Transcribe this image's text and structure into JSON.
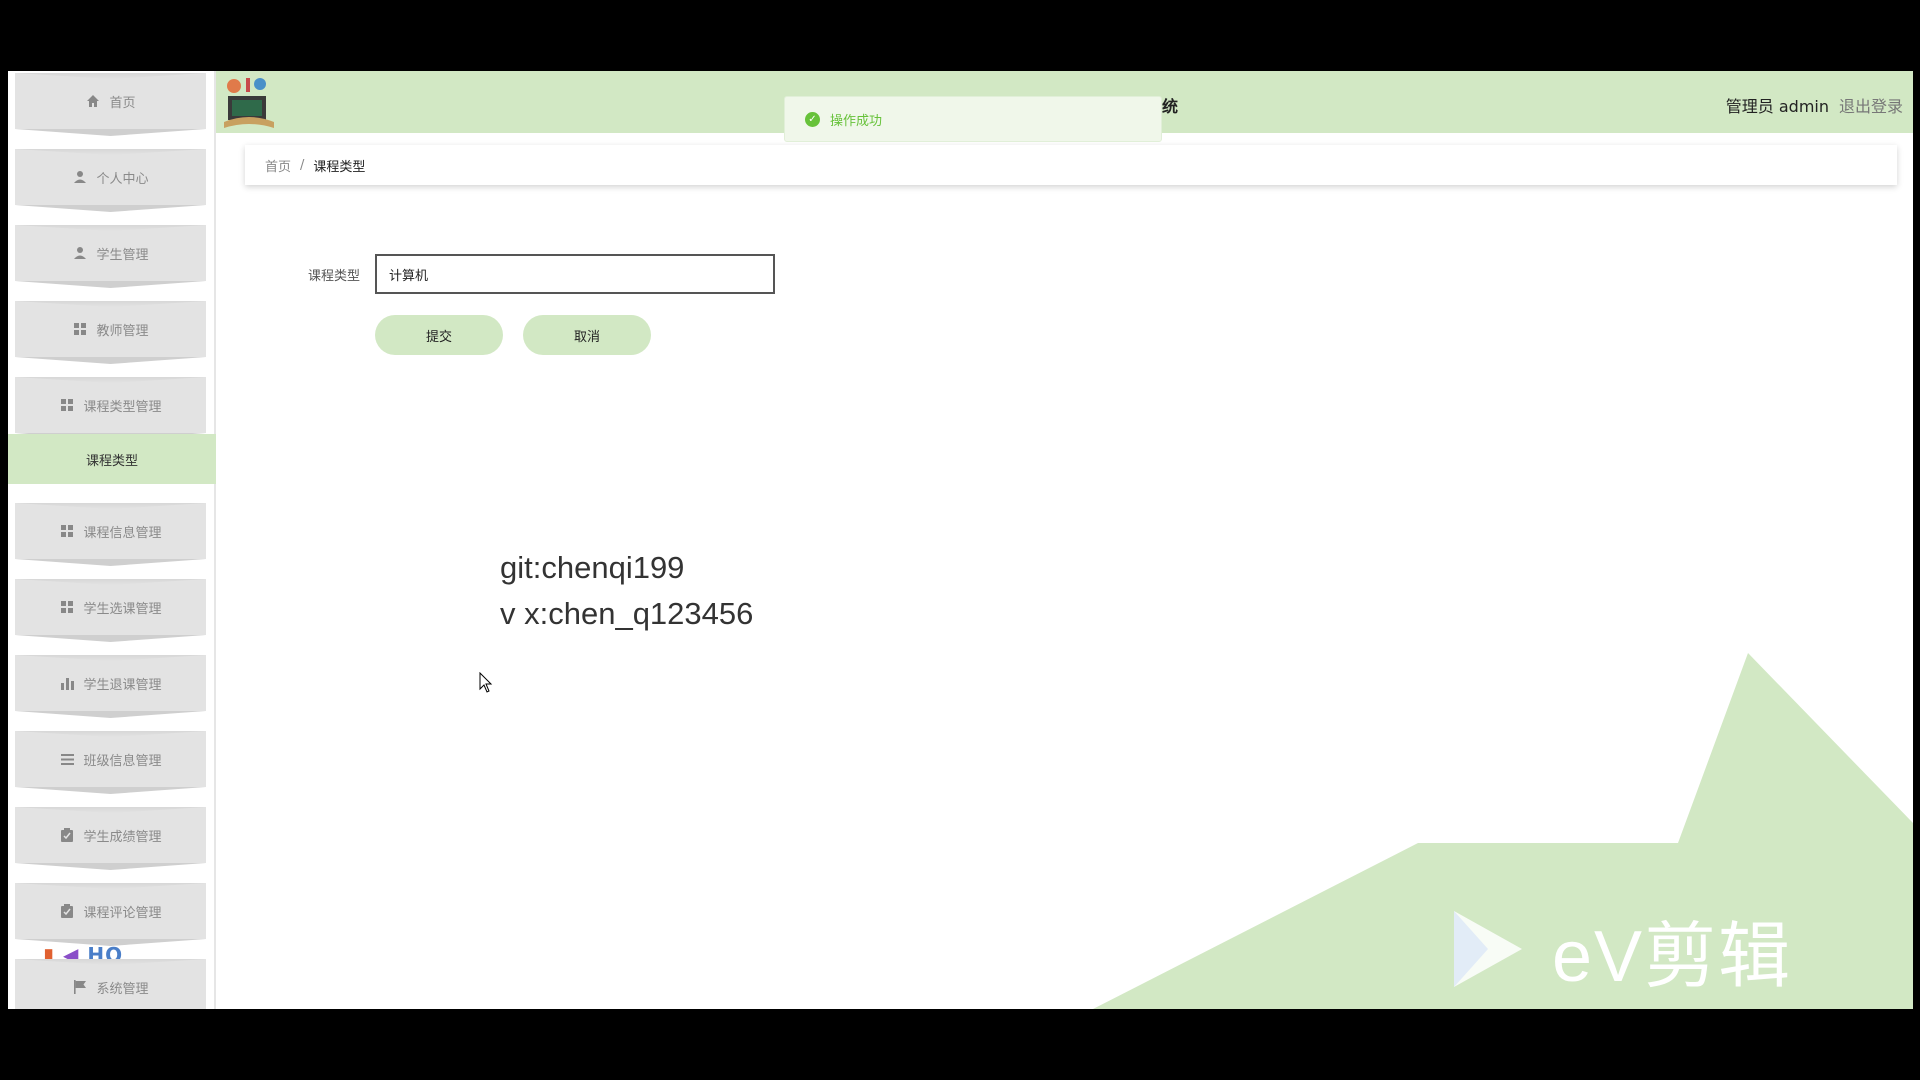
{
  "header": {
    "title": "系统",
    "user_label": "管理员 admin",
    "logout_label": "退出登录"
  },
  "toast": {
    "text": "操作成功"
  },
  "sidebar": {
    "items": [
      {
        "label": "首页",
        "icon": "home-icon"
      },
      {
        "label": "个人中心",
        "icon": "user-icon"
      },
      {
        "label": "学生管理",
        "icon": "user-icon"
      },
      {
        "label": "教师管理",
        "icon": "grid-icon"
      },
      {
        "label": "课程类型管理",
        "icon": "grid-icon"
      },
      {
        "label": "课程信息管理",
        "icon": "grid-icon"
      },
      {
        "label": "学生选课管理",
        "icon": "grid-icon"
      },
      {
        "label": "学生退课管理",
        "icon": "bar-chart-icon"
      },
      {
        "label": "班级信息管理",
        "icon": "list-icon"
      },
      {
        "label": "学生成绩管理",
        "icon": "clipboard-icon"
      },
      {
        "label": "课程评论管理",
        "icon": "clipboard-icon"
      },
      {
        "label": "系统管理",
        "icon": "flag-icon"
      }
    ],
    "active_submenu": "课程类型",
    "deco_text": "HO"
  },
  "breadcrumb": {
    "home": "首页",
    "separator": "/",
    "current": "课程类型"
  },
  "form": {
    "label": "课程类型",
    "value": "计算机",
    "submit_label": "提交",
    "cancel_label": "取消"
  },
  "watermark": {
    "line1": "git:chenqi199",
    "line2": "v x:chen_q123456"
  },
  "ev_logo": {
    "text": "eV剪辑"
  },
  "colors": {
    "accent": "#d2e8c4",
    "success": "#67c23a",
    "menu_bg": "#e3e3e3"
  }
}
